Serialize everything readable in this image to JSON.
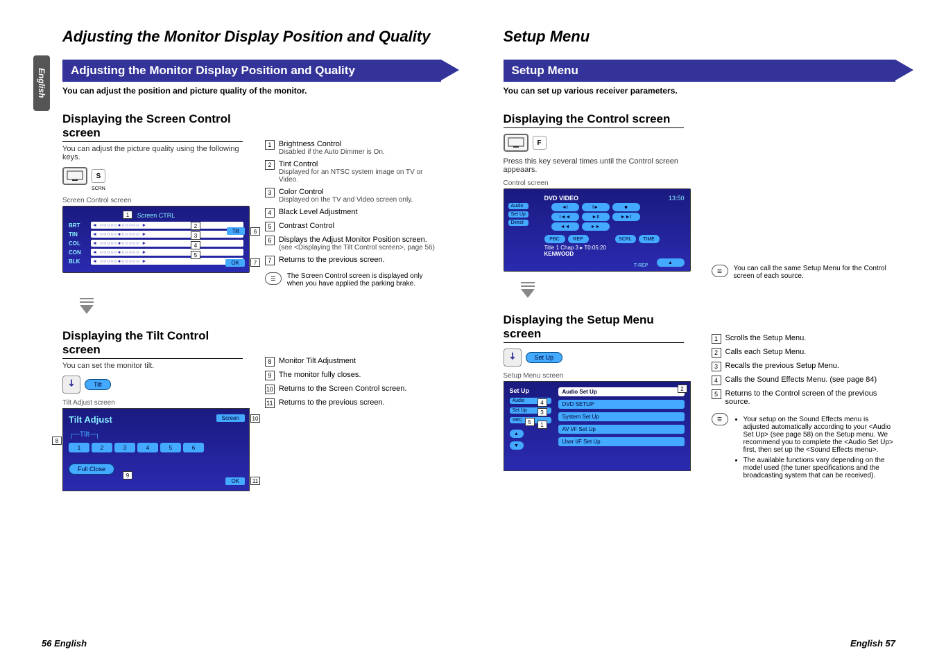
{
  "sideTab": "English",
  "leftPage": {
    "title": "Adjusting the Monitor Display Position and Quality",
    "banner": "Adjusting the Monitor Display Position and Quality",
    "intro": "You can adjust the position and picture quality of the monitor.",
    "heading1": "Displaying the Screen Control screen",
    "text1": "You can adjust the picture quality using the following keys.",
    "screenLabel1": "Screen Control screen",
    "screenTitle1": "Screen CTRL",
    "sliders": [
      "BRT",
      "TIN",
      "COL",
      "CON",
      "BLK"
    ],
    "tiltBtn": "Tilt",
    "okBtn": "OK",
    "items1": [
      {
        "n": "1",
        "t": "Brightness Control",
        "s": "Disabled if the Auto Dimmer is On."
      },
      {
        "n": "2",
        "t": "Tint Control",
        "s": "Displayed for an NTSC system image on TV or Video."
      },
      {
        "n": "3",
        "t": "Color Control",
        "s": "Displayed on the TV and Video screen only."
      },
      {
        "n": "4",
        "t": "Black Level Adjustment",
        "s": ""
      },
      {
        "n": "5",
        "t": "Contrast Control",
        "s": ""
      },
      {
        "n": "6",
        "t": "Displays the Adjust Monitor Position screen.",
        "s": "(see <Displaying the Tilt Control screen>, page 56)"
      },
      {
        "n": "7",
        "t": "Returns to the previous screen.",
        "s": ""
      }
    ],
    "note1": "The Screen Control screen is displayed only when you have applied the parking brake.",
    "heading2": "Displaying the Tilt Control screen",
    "text2": "You can set the monitor tilt.",
    "tiltLabel": "Tilt",
    "screenLabel2": "Tilt Adjust screen",
    "tiltTitle": "Tilt Adjust",
    "tiltSubLabel": "Tilt",
    "tiltNums": [
      "1",
      "2",
      "3",
      "4",
      "5",
      "6"
    ],
    "fullClose": "Full Close",
    "screenBtn": "Screen",
    "items2": [
      {
        "n": "8",
        "t": "Monitor Tilt Adjustment"
      },
      {
        "n": "9",
        "t": "The monitor fully closes."
      },
      {
        "n": "10",
        "t": "Returns to the Screen Control screen."
      },
      {
        "n": "11",
        "t": "Returns to the previous screen."
      }
    ],
    "footer": "56 English",
    "iconS": "S",
    "iconScrn": "SCRN"
  },
  "rightPage": {
    "title": "Setup Menu",
    "banner": "Setup Menu",
    "intro": "You can set up various receiver parameters.",
    "heading1": "Displaying the Control screen",
    "text1": "Press this key several times until the Control screen appeaars.",
    "iconF": "F",
    "screenLabel1": "Control screen",
    "dvdTitle": "DVD VIDEO",
    "dvdTime": "13:50",
    "dvdSide": [
      "Audio",
      "Set Up",
      "Direct"
    ],
    "dvdInfo1": "Title 1  Chap   3  ▸  T0:05:20",
    "dvdInfo2": "KENWOOD",
    "dvdTags": [
      "PBC",
      "REP",
      "SCRL",
      "TIME"
    ],
    "dvdTrep": "T-REP",
    "note1": "You can call the same Setup Menu for the Control screen of each source.",
    "heading2": "Displaying the Setup Menu screen",
    "setupBtn": "Set Up",
    "screenLabel2": "Setup Menu screen",
    "setupTitle": "Set Up",
    "setupSide": [
      "Audio",
      "Set Up",
      "SRC"
    ],
    "setupItems": [
      "Audio Set Up",
      "DVD SETUP",
      "System Set Up",
      "AV I/F Set Up",
      "User I/F Set Up"
    ],
    "items2": [
      {
        "n": "1",
        "t": "Scrolls the Setup Menu."
      },
      {
        "n": "2",
        "t": "Calls each Setup Menu."
      },
      {
        "n": "3",
        "t": "Recalls the previous Setup Menu."
      },
      {
        "n": "4",
        "t": "Calls the Sound Effects Menu. (see page 84)"
      },
      {
        "n": "5",
        "t": "Returns to the Control screen of the previous source."
      }
    ],
    "bullets": [
      "Your setup on the Sound Effects menu is adjusted automatically according to your <Audio Set Up> (see page 58) on the Setup menu. We recommend you to complete the <Audio Set Up> first, then set up the <Sound Effects menu>.",
      "The available functions vary depending on the model used (the tuner specifications and the broadcasting system that can be received)."
    ],
    "footer": "English 57"
  }
}
